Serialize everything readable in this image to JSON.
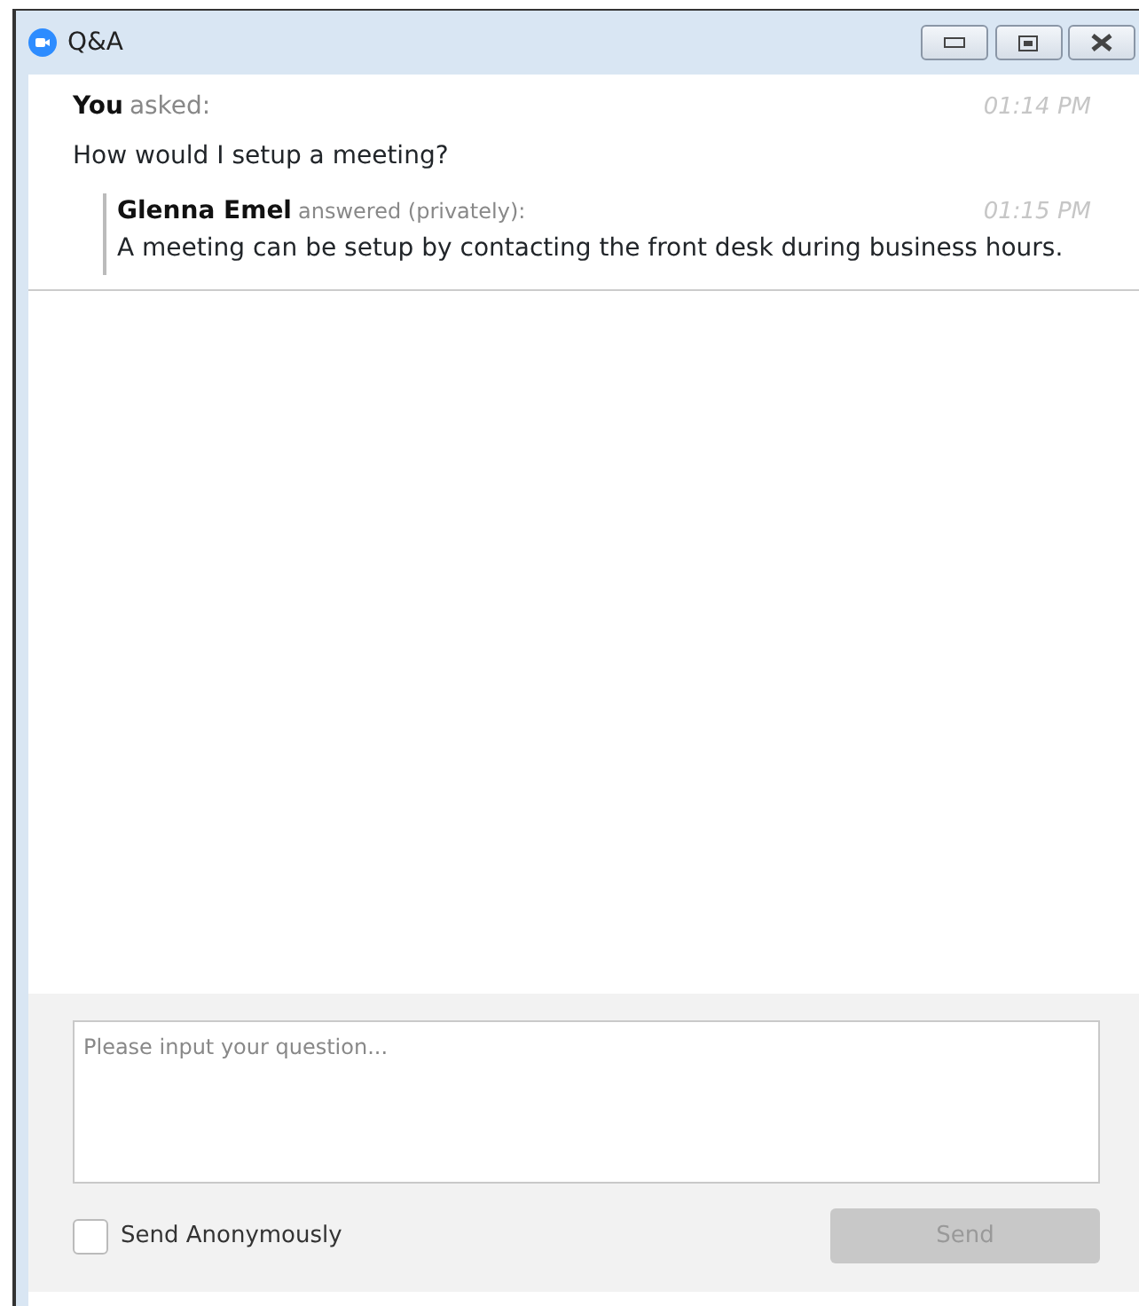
{
  "window": {
    "title": "Q&A"
  },
  "questions": [
    {
      "author": "You",
      "verb": "asked:",
      "time": "01:14 PM",
      "text": "How would I setup a meeting?",
      "answers": [
        {
          "author": "Glenna Emel",
          "verb": "answered (privately):",
          "time": "01:15 PM",
          "text": "A meeting can be setup by contacting the front desk during business hours."
        }
      ]
    }
  ],
  "composer": {
    "placeholder": "Please input your question...",
    "anonymous": {
      "label": "Send Anonymously",
      "checked": false
    },
    "send": {
      "label": "Send",
      "disabled": true
    }
  }
}
